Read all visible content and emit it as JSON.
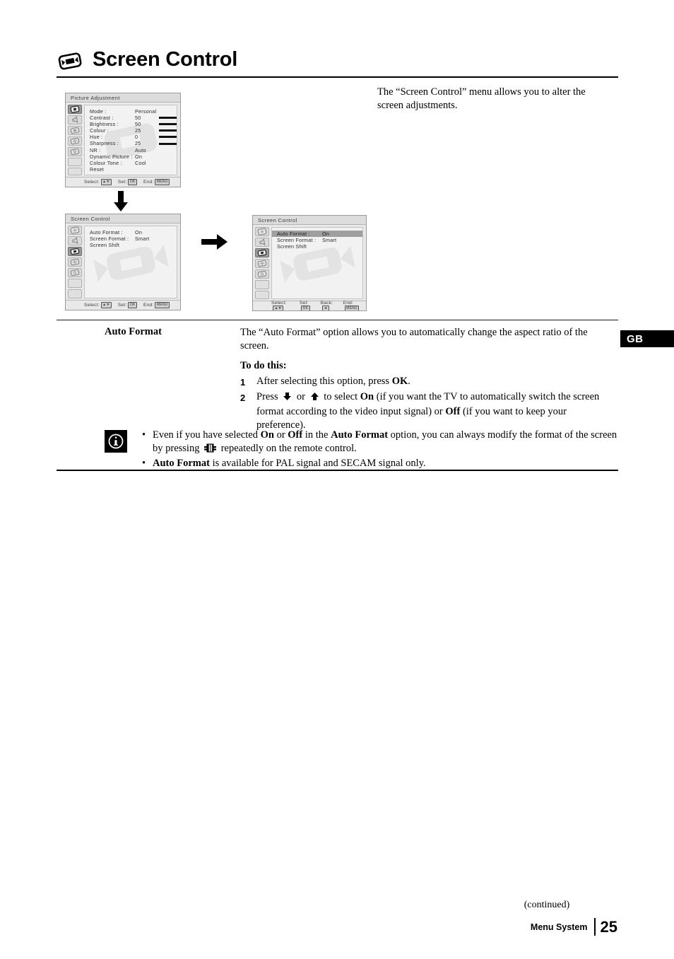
{
  "page": {
    "title": "Screen Control",
    "title_icon": "screen-format-icon",
    "lang_tab": "GB",
    "continued": "(continued)",
    "footer_section": "Menu System",
    "footer_page": "25"
  },
  "intro": {
    "text": "The “Screen Control” menu allows you to alter the screen adjustments."
  },
  "osd": {
    "picture": {
      "title": "Picture Adjustment",
      "rows": [
        {
          "label": "Mode :",
          "value": "Personal",
          "slider": false
        },
        {
          "label": "Contrast :",
          "value": "50",
          "slider": true
        },
        {
          "label": "Brightness :",
          "value": "50",
          "slider": true
        },
        {
          "label": "Colour :",
          "value": "25",
          "slider": true
        },
        {
          "label": "Hue :",
          "value": "0",
          "slider": true
        },
        {
          "label": "Sharpness :",
          "value": "25",
          "slider": true
        },
        {
          "label": "NR :",
          "value": "Auto",
          "slider": false
        },
        {
          "label": "Dynamic Picture :",
          "value": "On",
          "slider": false
        },
        {
          "label": "Colour Tone :",
          "value": "Cool",
          "slider": false
        },
        {
          "label": "Reset",
          "value": "",
          "slider": false
        }
      ],
      "footer": {
        "select": "Select:",
        "select_key": "▲▼",
        "set": "Set:",
        "set_key": "OK",
        "end": "End:",
        "end_key": "MENU"
      },
      "selected_rail_index": 0
    },
    "screen_before": {
      "title": "Screen Control",
      "rows": [
        {
          "label": "Auto Format :",
          "value": "On"
        },
        {
          "label": "Screen Format :",
          "value": "Smart"
        },
        {
          "label": "Screen Shift",
          "value": ""
        }
      ],
      "highlight_row": -1,
      "footer": {
        "select": "Select:",
        "select_key": "▲▼",
        "set": "Set:",
        "set_key": "OK",
        "end": "End:",
        "end_key": "MENU"
      },
      "selected_rail_index": 2
    },
    "screen_after": {
      "title": "Screen Control",
      "rows": [
        {
          "label": "Auto Format :",
          "value": "On"
        },
        {
          "label": "Screen Format :",
          "value": "Smart"
        },
        {
          "label": "Screen Shift",
          "value": ""
        }
      ],
      "highlight_row": 0,
      "footer": {
        "select": "Select:",
        "select_key": "▲▼",
        "set": "Set:",
        "set_key": "OK",
        "back": "Back:",
        "back_key": "◄",
        "end": "End:",
        "end_key": "MENU"
      },
      "selected_rail_index": 2
    }
  },
  "section": {
    "term": "Auto Format",
    "intro": "The “Auto Format” option allows you to automatically change the aspect ratio of the screen.",
    "todo": "To do this:",
    "steps": [
      {
        "n": "1",
        "parts": [
          {
            "t": "After selecting this option, press ",
            "b": false
          },
          {
            "t": "OK",
            "b": true
          },
          {
            "t": ".",
            "b": false
          }
        ]
      },
      {
        "n": "2",
        "parts": [
          {
            "t": "Press ",
            "b": false
          },
          {
            "t": "▼",
            "icon": "arrow-down-icon"
          },
          {
            "t": " or ",
            "b": false
          },
          {
            "t": "▲",
            "icon": "arrow-up-icon"
          },
          {
            "t": " to select ",
            "b": false
          },
          {
            "t": "On",
            "b": true
          },
          {
            "t": " (if you want the TV to automatically switch the screen format according to the video input signal) or ",
            "b": false
          },
          {
            "t": "Off",
            "b": true
          },
          {
            "t": " (if you want to keep your preference).",
            "b": false
          }
        ]
      }
    ]
  },
  "note": {
    "icon": "info-icon",
    "bullet": "•",
    "items": [
      {
        "parts": [
          {
            "t": "Even if you have selected ",
            "b": false
          },
          {
            "t": "On",
            "b": true
          },
          {
            "t": " or ",
            "b": false
          },
          {
            "t": "Off",
            "b": true
          },
          {
            "t": " in the ",
            "b": false
          },
          {
            "t": "Auto Format",
            "b": true
          },
          {
            "t": " option, you can always modify the format of the screen by pressing ",
            "b": false
          },
          {
            "t": "",
            "icon": "wide-format-icon"
          },
          {
            "t": " repeatedly on the remote control.",
            "b": false
          }
        ]
      },
      {
        "parts": [
          {
            "t": "Auto Format",
            "b": true
          },
          {
            "t": " is available for PAL signal and SECAM signal only.",
            "b": false
          }
        ]
      }
    ]
  }
}
